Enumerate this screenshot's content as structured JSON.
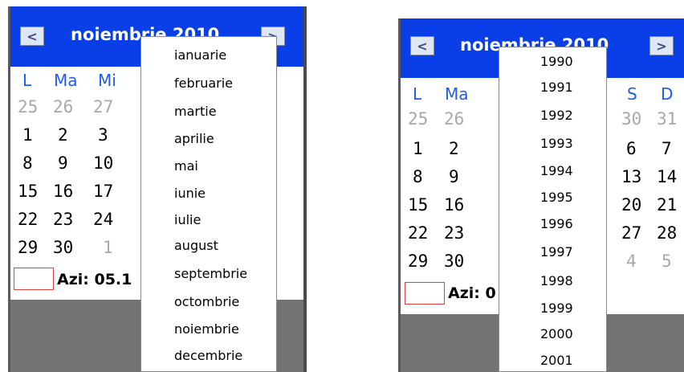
{
  "left_calendar": {
    "title": "noiembrie 2010",
    "prev_symbol": "<",
    "next_symbol": ">",
    "weekdays": [
      "L",
      "Ma",
      "Mi"
    ],
    "rows": [
      [
        "25",
        "26",
        "27"
      ],
      [
        "1",
        "2",
        "3"
      ],
      [
        "8",
        "9",
        "10"
      ],
      [
        "15",
        "16",
        "17"
      ],
      [
        "22",
        "23",
        "24"
      ],
      [
        "29",
        "30",
        "1"
      ]
    ],
    "today_label": "Azi: 05.1",
    "month_menu": [
      "ianuarie",
      "februarie",
      "martie",
      "aprilie",
      "mai",
      "iunie",
      "iulie",
      "august",
      "septembrie",
      "octombrie",
      "noiembrie",
      "decembrie"
    ]
  },
  "right_calendar": {
    "title": "noiembrie 2010",
    "prev_symbol": "<",
    "next_symbol": ">",
    "weekdays_left": [
      "L",
      "Ma"
    ],
    "weekdays_right": [
      "S",
      "D"
    ],
    "rows_left": [
      [
        "25",
        "26"
      ],
      [
        "1",
        "2"
      ],
      [
        "8",
        "9"
      ],
      [
        "15",
        "16"
      ],
      [
        "22",
        "23"
      ],
      [
        "29",
        "30"
      ]
    ],
    "rows_right": [
      [
        "30",
        "31"
      ],
      [
        "6",
        "7"
      ],
      [
        "13",
        "14"
      ],
      [
        "20",
        "21"
      ],
      [
        "27",
        "28"
      ],
      [
        "4",
        "5"
      ]
    ],
    "today_label": "Azi: 0",
    "year_menu": [
      "1990",
      "1991",
      "1992",
      "1993",
      "1994",
      "1995",
      "1996",
      "1997",
      "1998",
      "1999",
      "2000",
      "2001"
    ]
  },
  "colors": {
    "header_blue": "#0a3ee6",
    "weekday_blue": "#1e5bf0",
    "other_month_gray": "#a8a8a8",
    "today_border_red": "#e04040",
    "footer_gray": "#737373"
  }
}
